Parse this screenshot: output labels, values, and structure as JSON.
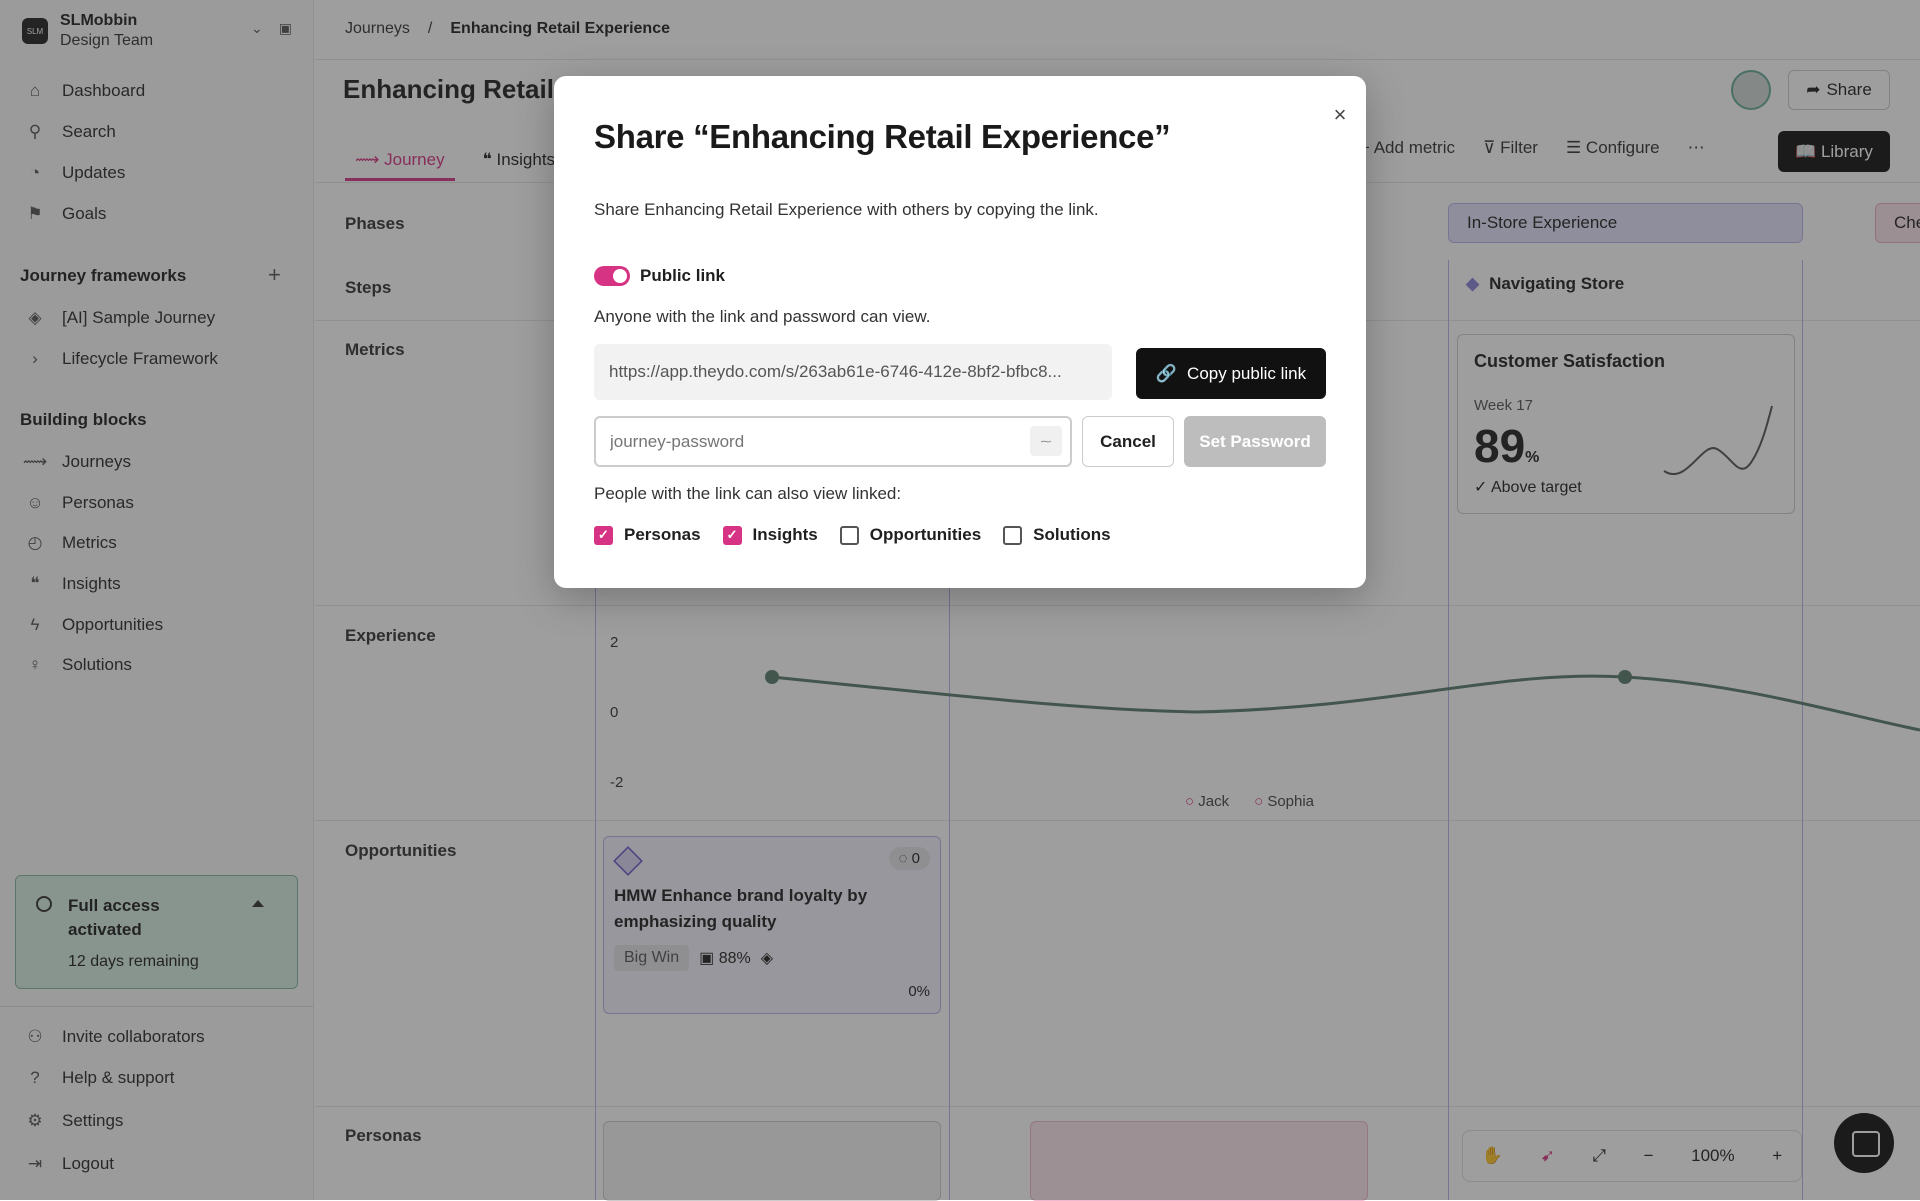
{
  "workspace": {
    "name": "SLMobbin",
    "team": "Design Team",
    "logo_text": "SLM"
  },
  "sidebar": {
    "nav": [
      {
        "label": "Dashboard",
        "icon": "home-icon"
      },
      {
        "label": "Search",
        "icon": "search-icon"
      },
      {
        "label": "Updates",
        "icon": "bell-icon"
      },
      {
        "label": "Goals",
        "icon": "flag-icon"
      }
    ],
    "frameworks_title": "Journey frameworks",
    "frameworks": [
      {
        "label": "[AI] Sample Journey",
        "icon": "framework-icon"
      },
      {
        "label": "Lifecycle Framework",
        "icon": "chevron-right-icon"
      }
    ],
    "blocks_title": "Building blocks",
    "blocks": [
      {
        "label": "Journeys",
        "icon": "journey-icon"
      },
      {
        "label": "Personas",
        "icon": "persona-icon"
      },
      {
        "label": "Metrics",
        "icon": "gauge-icon"
      },
      {
        "label": "Insights",
        "icon": "quote-icon"
      },
      {
        "label": "Opportunities",
        "icon": "bolt-icon"
      },
      {
        "label": "Solutions",
        "icon": "bulb-icon"
      }
    ],
    "trial": {
      "title": "Full access activated",
      "remaining": "12 days remaining"
    },
    "footer": [
      {
        "label": "Invite collaborators",
        "icon": "add-user-icon"
      },
      {
        "label": "Help & support",
        "icon": "help-icon"
      },
      {
        "label": "Settings",
        "icon": "gear-icon"
      },
      {
        "label": "Logout",
        "icon": "logout-icon"
      }
    ]
  },
  "header": {
    "breadcrumb": [
      "Journeys",
      "/",
      "Enhancing Retail Experience"
    ],
    "title": "Enhancing Retail E",
    "share_label": "Share",
    "tabs": [
      "Journey",
      "Insights"
    ],
    "toolbar": [
      "Add metric",
      "Filter",
      "Configure",
      "⋯"
    ],
    "library_label": "Library"
  },
  "board": {
    "rows": [
      "Phases",
      "Steps",
      "Metrics",
      "Experience",
      "Opportunities",
      "Personas"
    ],
    "phases": [
      "In-Store Experience",
      "Che"
    ],
    "step": "Navigating Store",
    "metric": {
      "title": "Customer Satisfaction",
      "week": "Week 17",
      "value": "89",
      "unit": "%",
      "status": "Above target"
    },
    "experience_axis": [
      "2",
      "0",
      "-2"
    ],
    "legend": [
      "Jack",
      "Sophia"
    ],
    "opportunity": {
      "title": "HMW Enhance brand loyalty by emphasizing quality",
      "tag": "Big Win",
      "score": "88%",
      "count": "0",
      "progress": "0%"
    },
    "zoom": "100%"
  },
  "modal": {
    "title": "Share “Enhancing Retail Experience”",
    "description": "Share Enhancing Retail Experience with others by copying the link.",
    "toggle_label": "Public link",
    "toggle_on": true,
    "access_text": "Anyone with the link and password can view.",
    "url": "https://app.theydo.com/s/263ab61e-6746-412e-8bf2-bfbc8...",
    "copy_label": "Copy public link",
    "password_placeholder": "journey-password",
    "cancel_label": "Cancel",
    "set_password_label": "Set Password",
    "linked_text": "People with the link can also view linked:",
    "linked_options": [
      {
        "label": "Personas",
        "checked": true
      },
      {
        "label": "Insights",
        "checked": true
      },
      {
        "label": "Opportunities",
        "checked": false
      },
      {
        "label": "Solutions",
        "checked": false
      }
    ]
  },
  "colors": {
    "accent": "#d63384",
    "primary_button": "#111111",
    "disabled_button": "#bdbdbd"
  }
}
